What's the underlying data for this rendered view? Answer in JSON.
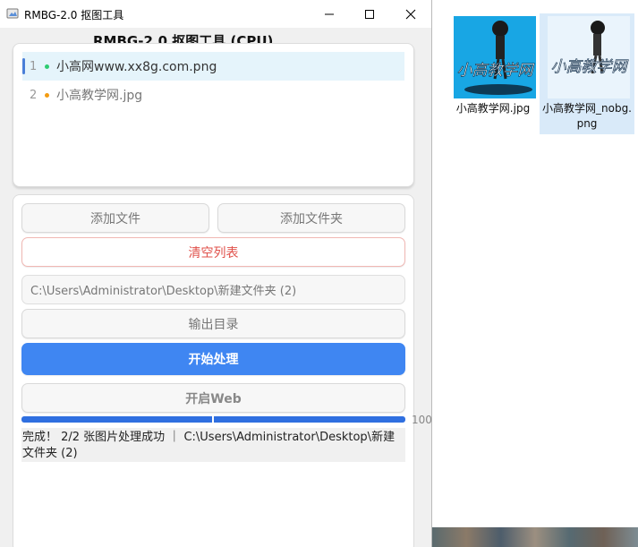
{
  "window": {
    "title": "RMBG-2.0 抠图工具",
    "icon": "app-icon",
    "controls": {
      "minimize": "minimize-icon",
      "maximize": "maximize-icon",
      "close": "close-icon"
    }
  },
  "app": {
    "heading": "RMBG-2.0  抠图工具 (CPU)"
  },
  "file_list": {
    "items": [
      {
        "index": "1",
        "name": "小高网www.xx8g.com.png",
        "dot_color": "#2ecc71",
        "selected": true
      },
      {
        "index": "2",
        "name": "小高教学网.jpg",
        "dot_color": "#f39c12",
        "selected": false
      }
    ]
  },
  "controls": {
    "add_file": "添加文件",
    "add_folder": "添加文件夹",
    "clear_list": "清空列表",
    "output_path": "C:\\Users\\Administrator\\Desktop\\新建文件夹 (2)",
    "output_dir": "输出目录",
    "start": "开始处理",
    "open_web": "开启Web"
  },
  "progress": {
    "value_percent": 100,
    "text": "100"
  },
  "status": {
    "text": "完成！ 2/2 张图片处理成功 ｜ C:\\Users\\Administrator\\Desktop\\新建文件夹 (2)"
  },
  "colors": {
    "accent": "#3f86f2",
    "danger": "#e0504a",
    "selected_row": "#e5f4fb",
    "progress": "#2f6fe0"
  },
  "desktop": {
    "files": [
      {
        "label": "小高教学网.jpg",
        "thumb_caption": "小高教学网",
        "selected": false
      },
      {
        "label": "小高教学网_nobg.png",
        "thumb_caption": "小高教学网",
        "selected": true
      }
    ]
  }
}
